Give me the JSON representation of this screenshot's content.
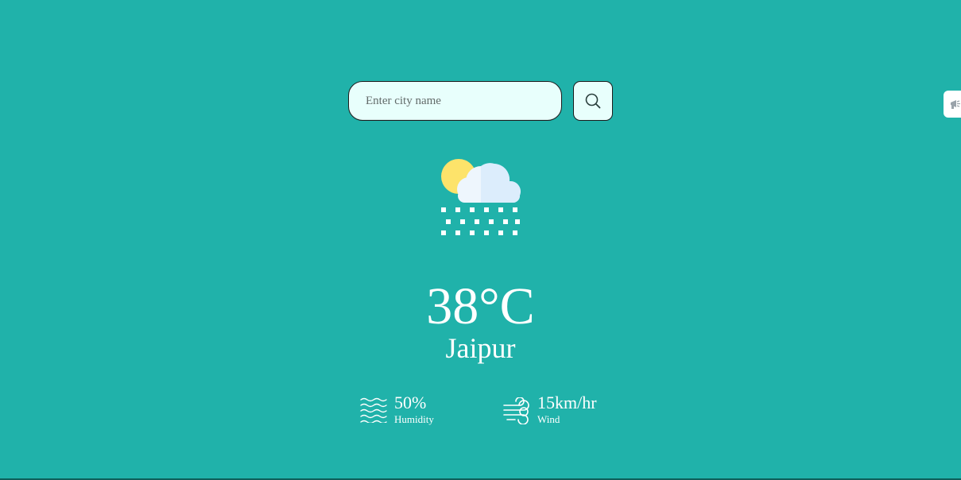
{
  "search": {
    "placeholder": "Enter city name",
    "value": "",
    "button_icon": "search-icon"
  },
  "weather": {
    "icon": "cloud-sun-rain-icon",
    "temperature": "38°C",
    "city": "Jaipur"
  },
  "details": {
    "humidity": {
      "icon": "humidity-waves-icon",
      "value": "50%",
      "label": "Humidity"
    },
    "wind": {
      "icon": "wind-icon",
      "value": "15km/hr",
      "label": "Wind"
    }
  },
  "side_tab": {
    "icon": "megaphone-icon"
  },
  "colors": {
    "background": "#20b2aa",
    "input_background": "#e8fffc",
    "text": "#ffffff",
    "sun": "#fde36a",
    "cloud": "#eef6fd"
  }
}
